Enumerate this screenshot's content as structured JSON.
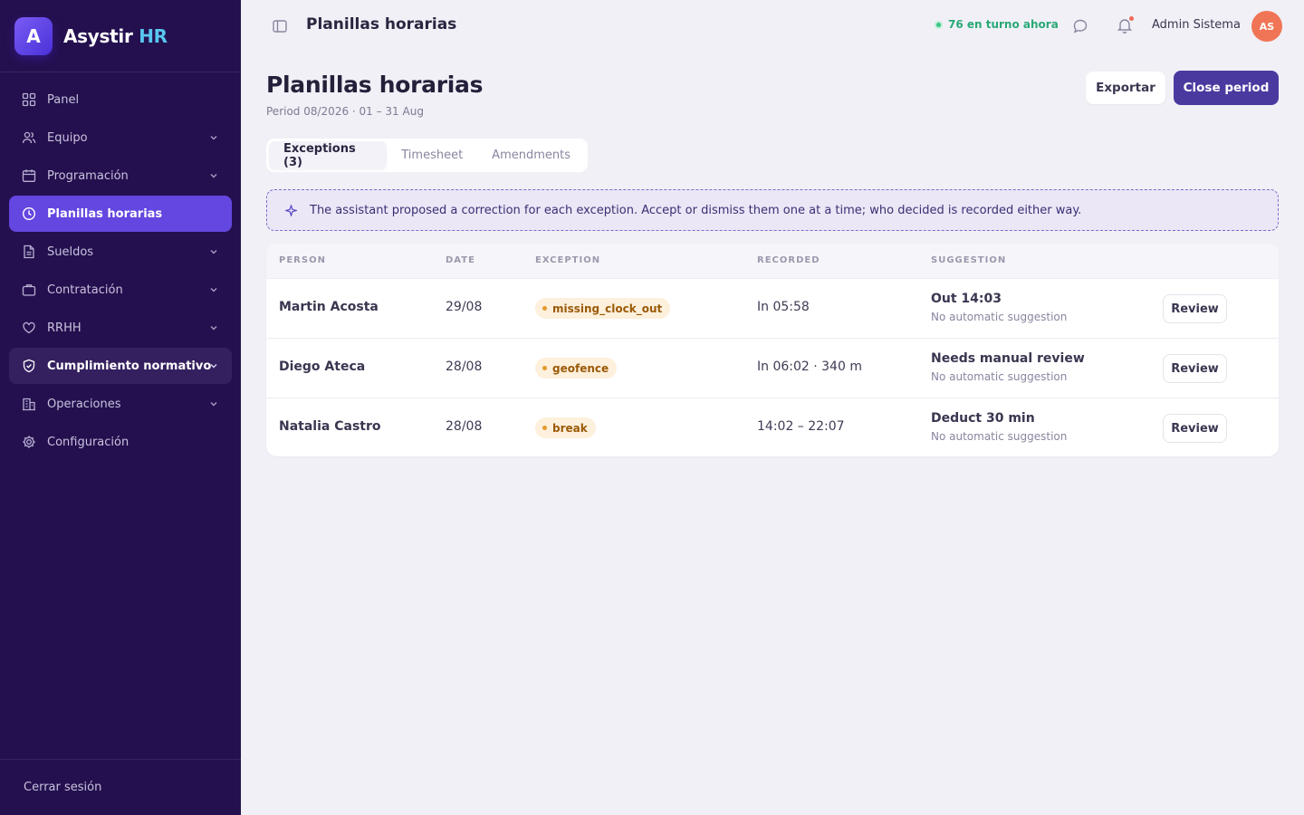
{
  "brand": {
    "logo_letter": "A",
    "name": "Asystir",
    "suffix": "HR"
  },
  "sidebar": {
    "items": [
      {
        "label": "Panel",
        "icon": "grid-icon"
      },
      {
        "label": "Equipo",
        "icon": "users-icon"
      },
      {
        "label": "Programación",
        "icon": "calendar-icon"
      },
      {
        "label": "Planillas horarias",
        "icon": "clock-icon"
      },
      {
        "label": "Sueldos",
        "icon": "document-icon"
      },
      {
        "label": "Contratación",
        "icon": "briefcase-icon"
      },
      {
        "label": "RRHH",
        "icon": "heart-icon"
      },
      {
        "label": "Cumplimiento normativo",
        "icon": "shield-icon"
      },
      {
        "label": "Operaciones",
        "icon": "building-icon"
      },
      {
        "label": "Configuración",
        "icon": "gear-icon"
      }
    ],
    "logout": "Cerrar sesión"
  },
  "topbar": {
    "title": "Planillas horarias",
    "status": "76 en turno ahora",
    "user_name": "Admin Sistema",
    "avatar_initials": "AS"
  },
  "page": {
    "title": "Planillas horarias",
    "subtitle": "Period 08/2026 · 01 – 31 Aug",
    "export_label": "Exportar",
    "close_label": "Close period"
  },
  "tabs": [
    {
      "label": "Exceptions (3)"
    },
    {
      "label": "Timesheet"
    },
    {
      "label": "Amendments"
    }
  ],
  "banner": "The assistant proposed a correction for each exception. Accept or dismiss them one at a time; who decided is recorded either way.",
  "table": {
    "headers": {
      "person": "PERSON",
      "date": "DATE",
      "exception": "EXCEPTION",
      "recorded": "RECORDED",
      "suggestion": "SUGGESTION"
    },
    "rows": [
      {
        "person": "Martin Acosta",
        "date": "29/08",
        "exception": "missing_clock_out",
        "recorded": "In 05:58",
        "suggestion": "Out 14:03",
        "note": "No automatic suggestion",
        "action": "Review"
      },
      {
        "person": "Diego Ateca",
        "date": "28/08",
        "exception": "geofence",
        "recorded": "In 06:02 · 340 m",
        "suggestion": "Needs manual review",
        "note": "No automatic suggestion",
        "action": "Review"
      },
      {
        "person": "Natalia Castro",
        "date": "28/08",
        "exception": "break",
        "recorded": "14:02 – 22:07",
        "suggestion": "Deduct 30 min",
        "note": "No automatic suggestion",
        "action": "Review"
      }
    ]
  },
  "colors": {
    "sidebar_bg": "#24104f",
    "accent": "#6446e0",
    "primary_button": "#4a3aa0",
    "status_green": "#2aa876",
    "badge_bg": "#fdf0dc",
    "avatar": "#f07556"
  }
}
